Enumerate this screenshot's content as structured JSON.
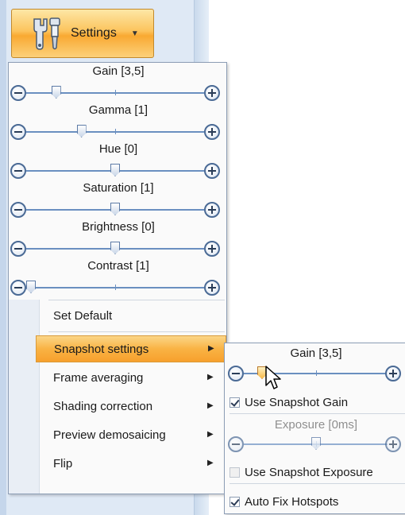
{
  "settings_button": {
    "label": "Settings",
    "icon": "wrench-screwdriver-icon"
  },
  "menu": {
    "sliders": [
      {
        "label": "Gain [3,5]",
        "level": 0.15
      },
      {
        "label": "Gamma [1]",
        "level": 0.3
      },
      {
        "label": "Hue [0]",
        "level": 0.5
      },
      {
        "label": "Saturation [1]",
        "level": 0.5
      },
      {
        "label": "Brightness [0]",
        "level": 0.5
      },
      {
        "label": "Contrast [1]",
        "level": 0.0
      }
    ],
    "items": [
      {
        "label": "Set Default",
        "submenu": false
      },
      {
        "label": "Snapshot settings",
        "submenu": true,
        "selected": true
      },
      {
        "label": "Frame averaging",
        "submenu": true
      },
      {
        "label": "Shading correction",
        "submenu": true
      },
      {
        "label": "Preview demosaicing",
        "submenu": true
      },
      {
        "label": "Flip",
        "submenu": true
      }
    ]
  },
  "submenu": {
    "gain_label": "Gain [3,5]",
    "gain_level": 0.1,
    "use_snapshot_gain": {
      "label": "Use Snapshot Gain",
      "checked": true
    },
    "exposure_label": "Exposure [0ms]",
    "exposure_level": 0.5,
    "use_snapshot_exposure": {
      "label": "Use Snapshot Exposure",
      "checked": false
    },
    "auto_fix_hotspots": {
      "label": "Auto Fix Hotspots",
      "checked": true
    }
  },
  "colors": {
    "accent": "#f9b344",
    "track": "#6a8fc0",
    "border": "#8c9db5"
  }
}
